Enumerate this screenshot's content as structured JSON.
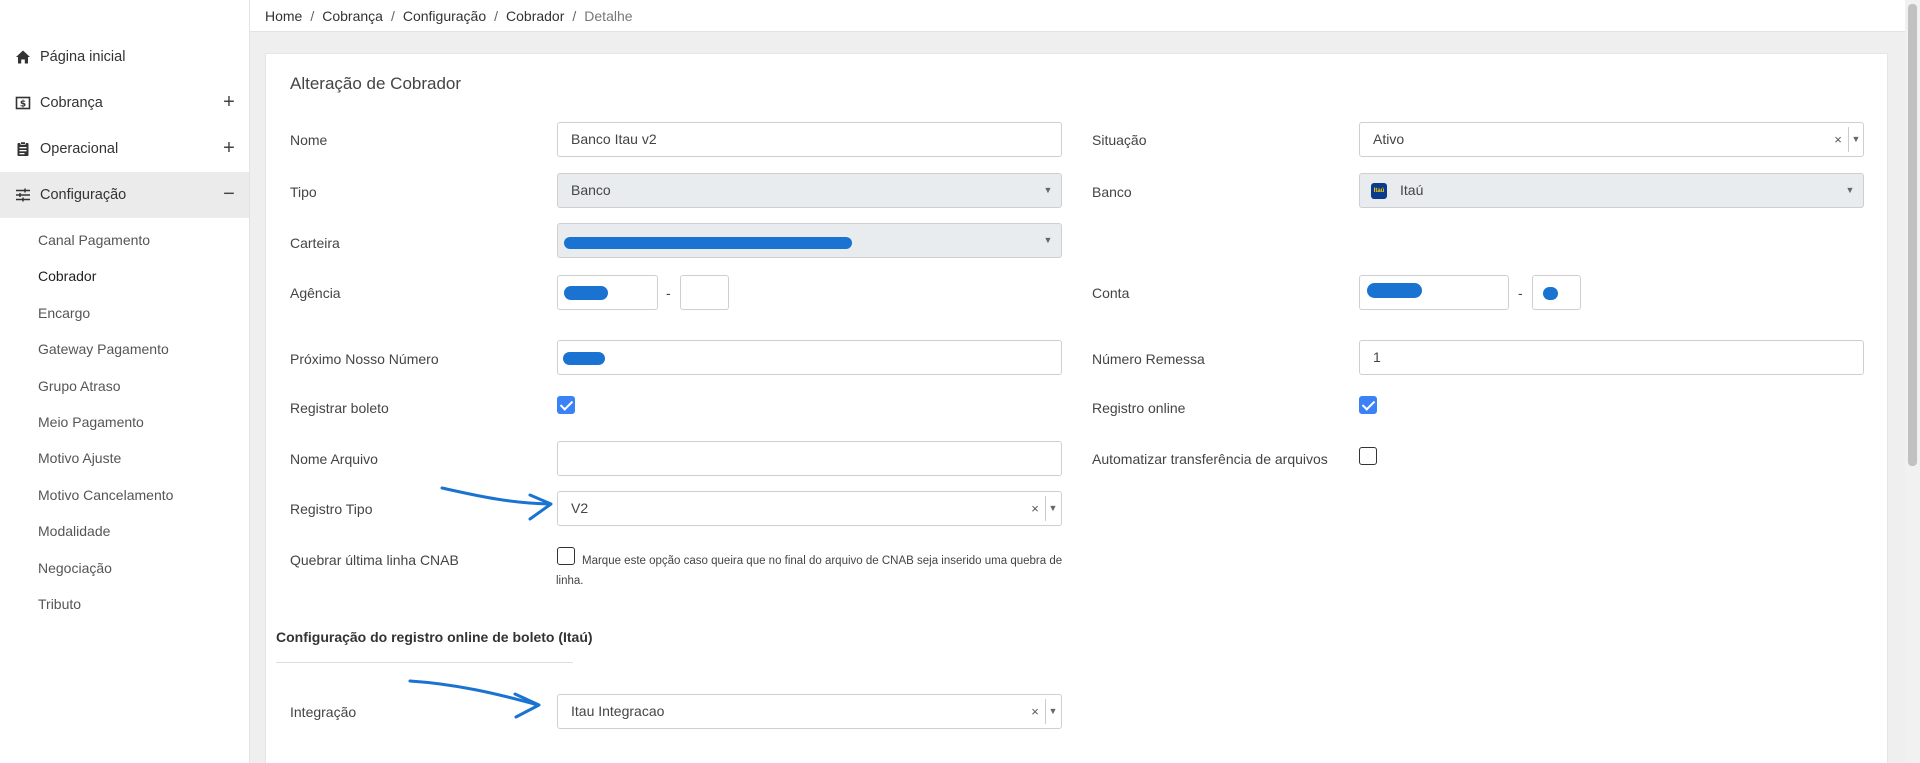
{
  "sidebar": {
    "items": [
      {
        "label": "Página inicial",
        "icon": "home-icon",
        "toggle": ""
      },
      {
        "label": "Cobrança",
        "icon": "dollar-icon",
        "toggle": "+"
      },
      {
        "label": "Operacional",
        "icon": "clipboard-icon",
        "toggle": "+"
      },
      {
        "label": "Configuração",
        "icon": "sliders-icon",
        "toggle": "−"
      }
    ],
    "subitems": [
      "Canal Pagamento",
      "Cobrador",
      "Encargo",
      "Gateway Pagamento",
      "Grupo Atraso",
      "Meio Pagamento",
      "Motivo Ajuste",
      "Motivo Cancelamento",
      "Modalidade",
      "Negociação",
      "Tributo"
    ],
    "active_subitem": "Cobrador"
  },
  "breadcrumb": [
    "Home",
    "Cobrança",
    "Configuração",
    "Cobrador",
    "Detalhe"
  ],
  "form": {
    "title": "Alteração de Cobrador",
    "nome": {
      "label": "Nome",
      "value": "Banco Itau v2"
    },
    "situacao": {
      "label": "Situação",
      "value": "Ativo"
    },
    "tipo": {
      "label": "Tipo",
      "value": "Banco"
    },
    "banco": {
      "label": "Banco",
      "value": "Itaú",
      "logo_text": "Itaú"
    },
    "carteira": {
      "label": "Carteira"
    },
    "agencia": {
      "label": "Agência",
      "dash": "-"
    },
    "conta": {
      "label": "Conta",
      "dash": "-"
    },
    "proximo_nosso_numero": {
      "label": "Próximo Nosso Número"
    },
    "numero_remessa": {
      "label": "Número Remessa",
      "value": "1"
    },
    "registrar_boleto": {
      "label": "Registrar boleto",
      "checked": true
    },
    "registro_online": {
      "label": "Registro online",
      "checked": true
    },
    "nome_arquivo": {
      "label": "Nome Arquivo",
      "value": ""
    },
    "automatizar": {
      "label": "Automatizar transferência de arquivos",
      "checked": false
    },
    "registro_tipo": {
      "label": "Registro Tipo",
      "value": "V2"
    },
    "quebrar": {
      "label": "Quebrar última linha CNAB",
      "checked": false,
      "help": "Marque este opção caso queira que no final do arquivo de CNAB seja inserido uma quebra de linha."
    },
    "section_title": "Configuração do registro online de boleto (Itaú)",
    "integracao": {
      "label": "Integração",
      "value": "Itau Integracao"
    }
  },
  "select_symbols": {
    "clear": "×",
    "arrow": "▼"
  },
  "colors": {
    "accent": "#3b82f6",
    "annotation": "#1a73d1",
    "itau_logo": "#0b3b8c"
  }
}
